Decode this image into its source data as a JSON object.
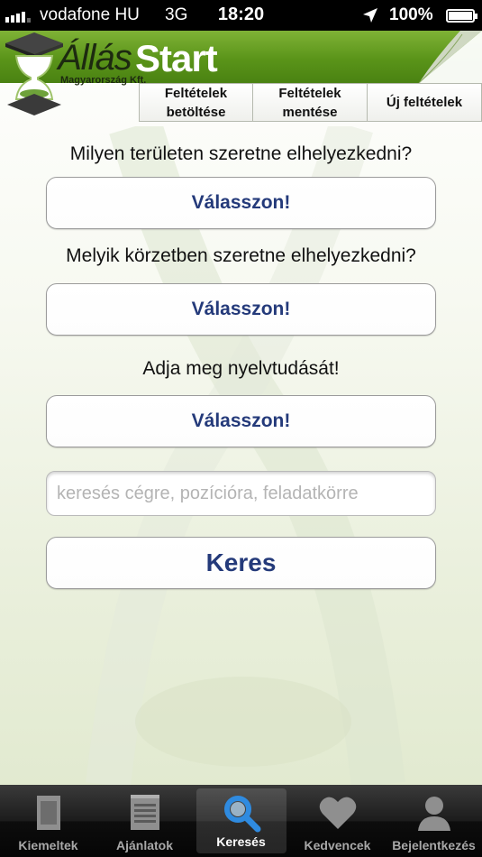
{
  "status_bar": {
    "carrier": "vodafone HU",
    "network": "3G",
    "time": "18:20",
    "battery": "100%"
  },
  "header": {
    "brand_part1": "Állás",
    "brand_part2": "Start",
    "brand_sub": "Magyarország Kft.",
    "colors": {
      "header_green": "#5a9419",
      "link_blue": "#243a7a"
    }
  },
  "top_tabs": [
    {
      "label_line1": "Feltételek",
      "label_line2": "betöltése"
    },
    {
      "label_line1": "Feltételek",
      "label_line2": "mentése"
    },
    {
      "label_line1": "Új feltételek",
      "label_line2": ""
    }
  ],
  "form": {
    "q1": "Milyen területen szeretne elhelyezkedni?",
    "q2": "Melyik körzetben szeretne elhelyezkedni?",
    "q3": "Adja meg nyelvtudását!",
    "select_label": "Válasszon!",
    "search_placeholder": "keresés cégre, pozícióra, feladatkörre",
    "search_value": "",
    "search_button": "Keres"
  },
  "tab_bar": {
    "items": [
      {
        "label": "Kiemeltek",
        "icon": "highlight-card-icon"
      },
      {
        "label": "Ajánlatok",
        "icon": "notepad-icon"
      },
      {
        "label": "Keresés",
        "icon": "search-icon"
      },
      {
        "label": "Kedvencek",
        "icon": "heart-icon"
      },
      {
        "label": "Bejelentkezés",
        "icon": "person-icon"
      }
    ],
    "active_index": 2
  }
}
